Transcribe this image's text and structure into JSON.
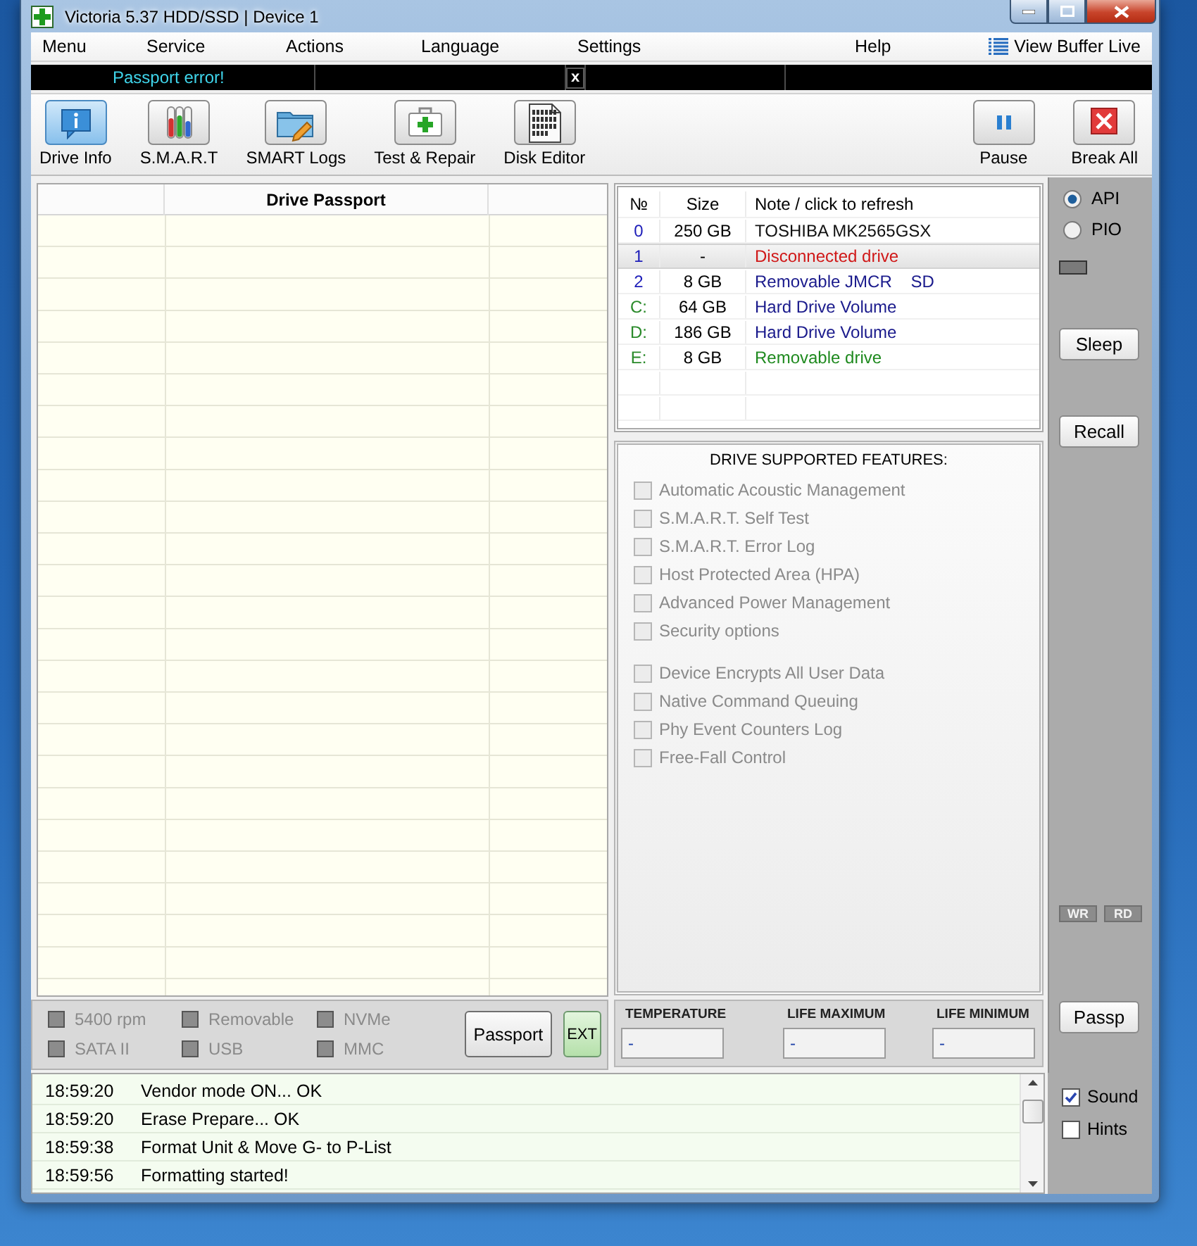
{
  "window": {
    "title": "Victoria 5.37 HDD/SSD | Device 1"
  },
  "menu": {
    "items": [
      {
        "label": "Menu"
      },
      {
        "label": "Service"
      },
      {
        "label": "Actions"
      },
      {
        "label": "Language"
      },
      {
        "label": "Settings"
      },
      {
        "label": "Help"
      }
    ],
    "view_buffer": {
      "label": "View Buffer Live"
    }
  },
  "status_strip": {
    "message": "Passport error!",
    "close": "x"
  },
  "toolbar": {
    "left": [
      {
        "label": "Drive Info",
        "selected": true
      },
      {
        "label": "S.M.A.R.T",
        "selected": false
      },
      {
        "label": "SMART Logs",
        "selected": false
      },
      {
        "label": "Test & Repair",
        "selected": false
      },
      {
        "label": "Disk Editor",
        "selected": false
      }
    ],
    "right": [
      {
        "label": "Pause"
      },
      {
        "label": "Break All"
      }
    ]
  },
  "passport": {
    "title": "Drive Passport"
  },
  "drive_flags": [
    {
      "label": "5400 rpm",
      "on": false
    },
    {
      "label": "Removable",
      "on": false
    },
    {
      "label": "NVMe",
      "on": false
    },
    {
      "label": "SATA II",
      "on": false
    },
    {
      "label": "USB",
      "on": false
    },
    {
      "label": "MMC",
      "on": false
    }
  ],
  "passport_buttons": [
    {
      "label": "Passport",
      "on": false
    },
    {
      "label": "EXT",
      "on": true
    }
  ],
  "drives": {
    "columns": [
      "№",
      "Size",
      "Note / click to refresh"
    ],
    "rows": [
      {
        "no": "0",
        "size": "250 GB",
        "note": "TOSHIBA MK2565GSX",
        "kind": "device",
        "color": "#101010",
        "selected": false
      },
      {
        "no": "1",
        "size": "-",
        "note": "Disconnected drive",
        "kind": "device",
        "color": "#d01818",
        "selected": true
      },
      {
        "no": "2",
        "size": "8 GB",
        "note": "Removable JMCR    SD",
        "kind": "device",
        "color": "#1a1a8c",
        "selected": false
      },
      {
        "no": "C:",
        "size": "64 GB",
        "note": "Hard Drive Volume",
        "kind": "volume",
        "color": "#1a1a8c",
        "selected": false
      },
      {
        "no": "D:",
        "size": "186 GB",
        "note": "Hard Drive Volume",
        "kind": "volume",
        "color": "#1a1a8c",
        "selected": false
      },
      {
        "no": "E:",
        "size": "8 GB",
        "note": "Removable drive",
        "kind": "volume",
        "color": "#1f8a1f",
        "selected": false
      }
    ]
  },
  "features": {
    "title": "DRIVE SUPPORTED FEATURES:",
    "groups": [
      {
        "items": [
          {
            "label": "Automatic Acoustic Management",
            "checked": false,
            "disabled": true
          },
          {
            "label": "S.M.A.R.T. Self Test",
            "checked": false,
            "disabled": true
          },
          {
            "label": "S.M.A.R.T. Error Log",
            "checked": false,
            "disabled": true
          },
          {
            "label": "Host Protected Area (HPA)",
            "checked": false,
            "disabled": true
          },
          {
            "label": "Advanced Power Management",
            "checked": false,
            "disabled": true
          },
          {
            "label": "Security options",
            "checked": false,
            "disabled": true
          }
        ]
      },
      {
        "items": [
          {
            "label": "Device Encrypts All User Data",
            "checked": false,
            "disabled": true
          },
          {
            "label": "Native Command Queuing",
            "checked": false,
            "disabled": true
          },
          {
            "label": "Phy Event Counters Log",
            "checked": false,
            "disabled": true
          },
          {
            "label": "Free-Fall Control",
            "checked": false,
            "disabled": true
          }
        ]
      }
    ]
  },
  "sensors": [
    {
      "label": "TEMPERATURE",
      "value": "-"
    },
    {
      "label": "LIFE MAXIMUM",
      "value": "-"
    },
    {
      "label": "LIFE MINIMUM",
      "value": "-"
    }
  ],
  "mode": [
    {
      "label": "API",
      "selected": true
    },
    {
      "label": "PIO",
      "selected": false
    }
  ],
  "side_buttons": [
    {
      "label": "Sleep"
    },
    {
      "label": "Recall"
    }
  ],
  "lamps": [
    {
      "label": "WR"
    },
    {
      "label": "RD"
    }
  ],
  "passp_button": {
    "label": "Passp"
  },
  "log": {
    "entries": [
      {
        "time": "18:59:20",
        "message": "Vendor mode ON... OK"
      },
      {
        "time": "18:59:20",
        "message": "Erase Prepare... OK"
      },
      {
        "time": "18:59:38",
        "message": "Format Unit & Move G- to P-List"
      },
      {
        "time": "18:59:56",
        "message": "Formatting started!"
      }
    ]
  },
  "options": [
    {
      "label": "Sound",
      "checked": true
    },
    {
      "label": "Hints",
      "checked": false
    }
  ]
}
